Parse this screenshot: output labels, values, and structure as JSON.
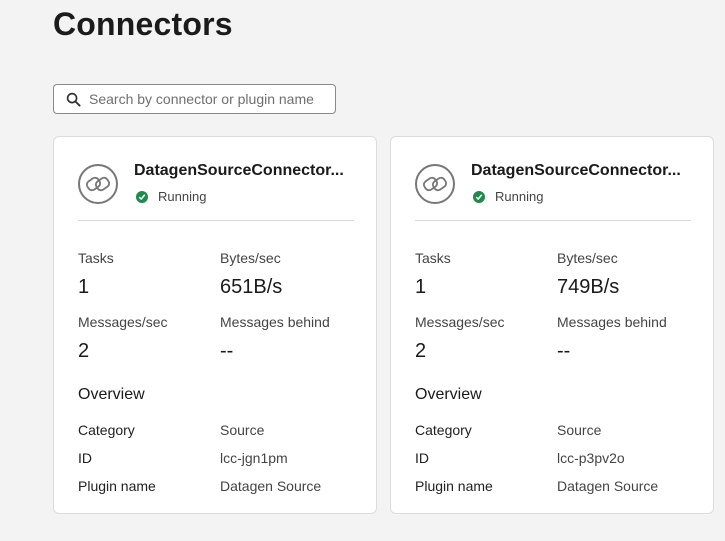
{
  "page": {
    "title": "Connectors"
  },
  "search": {
    "placeholder": "Search by connector or plugin name"
  },
  "connectors": [
    {
      "name": "DatagenSourceConnector...",
      "status": "Running",
      "metrics": {
        "tasks_label": "Tasks",
        "tasks": "1",
        "bytes_label": "Bytes/sec",
        "bytes": "651B/s",
        "messages_label": "Messages/sec",
        "messages": "2",
        "behind_label": "Messages behind",
        "behind": "--"
      },
      "overview": {
        "title": "Overview",
        "category_label": "Category",
        "category": "Source",
        "id_label": "ID",
        "id": "lcc-jgn1pm",
        "plugin_label": "Plugin name",
        "plugin": "Datagen Source"
      }
    },
    {
      "name": "DatagenSourceConnector...",
      "status": "Running",
      "metrics": {
        "tasks_label": "Tasks",
        "tasks": "1",
        "bytes_label": "Bytes/sec",
        "bytes": "749B/s",
        "messages_label": "Messages/sec",
        "messages": "2",
        "behind_label": "Messages behind",
        "behind": "--"
      },
      "overview": {
        "title": "Overview",
        "category_label": "Category",
        "category": "Source",
        "id_label": "ID",
        "id": "lcc-p3pv2o",
        "plugin_label": "Plugin name",
        "plugin": "Datagen Source"
      }
    }
  ],
  "colors": {
    "status_running": "#1e8a4c",
    "background": "#f3f3f3",
    "card": "#ffffff"
  },
  "icons": {
    "search": "search-icon",
    "connector": "connector-link-icon",
    "status": "check-circle-icon"
  }
}
